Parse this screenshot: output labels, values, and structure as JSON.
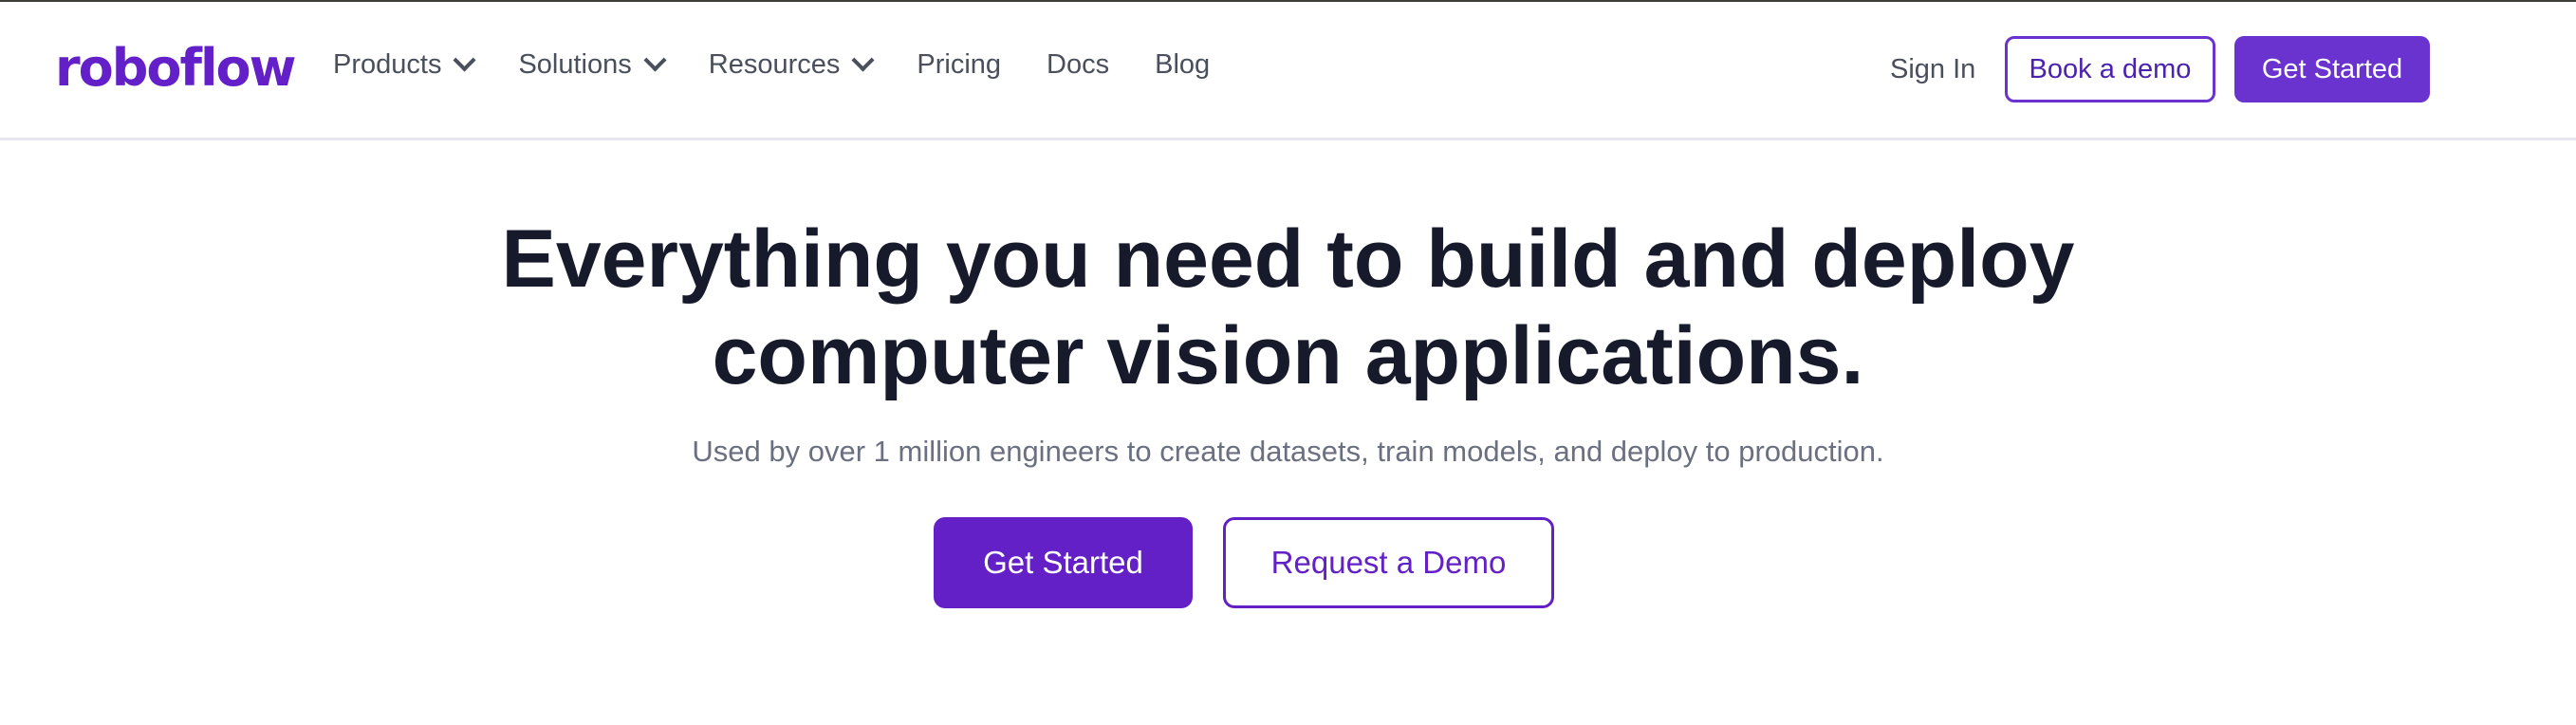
{
  "header": {
    "logo": "roboflow",
    "nav": [
      {
        "label": "Products",
        "dropdown": true
      },
      {
        "label": "Solutions",
        "dropdown": true
      },
      {
        "label": "Resources",
        "dropdown": true
      },
      {
        "label": "Pricing",
        "dropdown": false
      },
      {
        "label": "Docs",
        "dropdown": false
      },
      {
        "label": "Blog",
        "dropdown": false
      }
    ],
    "sign_in": "Sign In",
    "book_demo": "Book a demo",
    "get_started": "Get Started"
  },
  "hero": {
    "title_line1": "Everything you need to build and deploy",
    "title_line2": "computer vision applications.",
    "subtitle": "Used by over 1 million engineers to create datasets, train models, and deploy to production.",
    "primary_cta": "Get Started",
    "secondary_cta": "Request a Demo"
  },
  "colors": {
    "brand": "#6420c8",
    "header_button": "#6a33cf",
    "heading": "#171a2b"
  }
}
